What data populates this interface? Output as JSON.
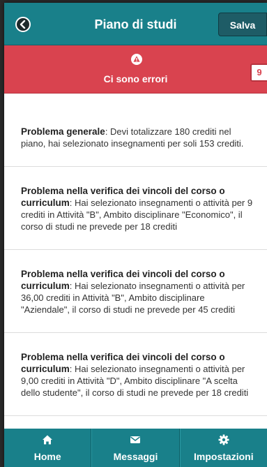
{
  "header": {
    "title": "Piano di studi",
    "save_label": "Salva"
  },
  "error_banner": {
    "text": "Ci sono errori",
    "count": "9"
  },
  "problems": [
    {
      "title": "Problema generale",
      "text": ": Devi totalizzare 180 crediti nel piano, hai selezionato insegnamenti per soli 153 crediti."
    },
    {
      "title": "Problema nella verifica dei vincoli del corso o curriculum",
      "text": ": Hai selezionato insegnamenti o attività per 9 crediti in Attività \"B\", Ambito disciplinare \"Economico\", il corso di studi ne prevede per 18 crediti"
    },
    {
      "title": "Problema nella verifica dei vincoli del corso o curriculum",
      "text": ": Hai selezionato insegnamenti o attività per 36,00 crediti in Attività \"B\", Ambito disciplinare \"Aziendale\", il corso di studi ne prevede per 45 crediti"
    },
    {
      "title": "Problema nella verifica dei vincoli del corso o curriculum",
      "text": ": Hai selezionato insegnamenti o attività per 9,00 crediti in Attività \"D\", Ambito disciplinare \"A scelta dello studente\", il corso di studi ne prevede per 18 crediti"
    }
  ],
  "tabbar": {
    "home": "Home",
    "messages": "Messaggi",
    "settings": "Impostazioni"
  },
  "colors": {
    "header": "#19808a",
    "error": "#d9434f",
    "save_button": "#1e5c66"
  },
  "icons": {
    "back": "chevron-left-icon",
    "warning": "warning-icon",
    "home": "home-icon",
    "messages": "envelope-icon",
    "settings": "gear-icon"
  }
}
